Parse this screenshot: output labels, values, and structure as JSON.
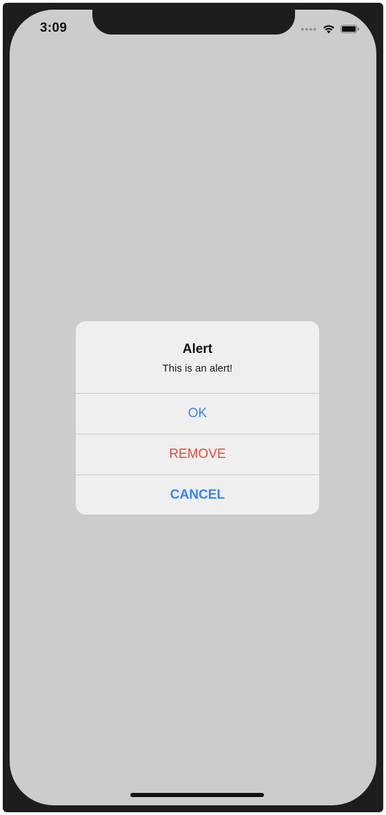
{
  "status_bar": {
    "time": "3:09",
    "icons": [
      "cellular-signal-icon",
      "wifi-icon",
      "battery-icon"
    ]
  },
  "alert": {
    "title": "Alert",
    "message": "This is an alert!",
    "buttons": [
      {
        "label": "OK",
        "color": "#3a82f7",
        "style": "default"
      },
      {
        "label": "REMOVE",
        "color": "#e5493a",
        "style": "destructive"
      },
      {
        "label": "CANCEL",
        "color": "#3a82f7",
        "style": "cancel"
      }
    ]
  },
  "colors": {
    "screen_background": "#cccccc",
    "alert_background": "#efefef",
    "accent": "#3a82f7",
    "destructive": "#e5493a"
  }
}
